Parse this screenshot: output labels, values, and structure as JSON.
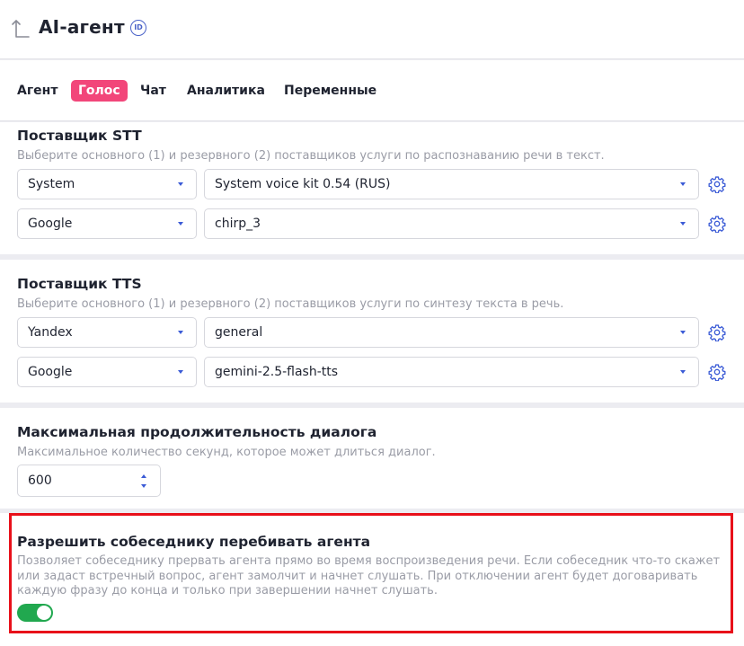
{
  "header": {
    "title": "AI-агент",
    "id_badge": "ID"
  },
  "tabs": [
    {
      "label": "Агент",
      "active": false
    },
    {
      "label": "Голос",
      "active": true
    },
    {
      "label": "Чат",
      "active": false
    },
    {
      "label": "Аналитика",
      "active": false
    },
    {
      "label": "Переменные",
      "active": false
    }
  ],
  "stt": {
    "title": "Поставщик STT",
    "description": "Выберите основного (1) и резервного (2) поставщиков услуги по распознаванию речи в текст.",
    "rows": [
      {
        "provider": "System",
        "model": "System voice kit 0.54 (RUS)"
      },
      {
        "provider": "Google",
        "model": "chirp_3"
      }
    ]
  },
  "tts": {
    "title": "Поставщик TTS",
    "description": "Выберите основного (1) и резервного (2) поставщиков услуги по синтезу текста в речь.",
    "rows": [
      {
        "provider": "Yandex",
        "model": "general"
      },
      {
        "provider": "Google",
        "model": "gemini-2.5-flash-tts"
      }
    ]
  },
  "duration": {
    "title": "Максимальная продолжительность диалога",
    "description": "Максимальное количество секунд, которое может длиться диалог.",
    "value": "600"
  },
  "interrupt": {
    "title": "Разрешить собеседнику перебивать агента",
    "description": "Позволяет собеседнику прервать агента прямо во время воспроизведения речи. Если собеседник что-то скажет или задаст встречный вопрос, агент замолчит и начнет слушать. При отключении агент будет договаривать каждую фразу до конца и только при завершении начнет слушать.",
    "enabled": true
  },
  "colors": {
    "accent_pink": "#f2467a",
    "accent_blue": "#3b5bd6",
    "toggle_green": "#21a84f",
    "highlight_red": "#e8101a"
  }
}
